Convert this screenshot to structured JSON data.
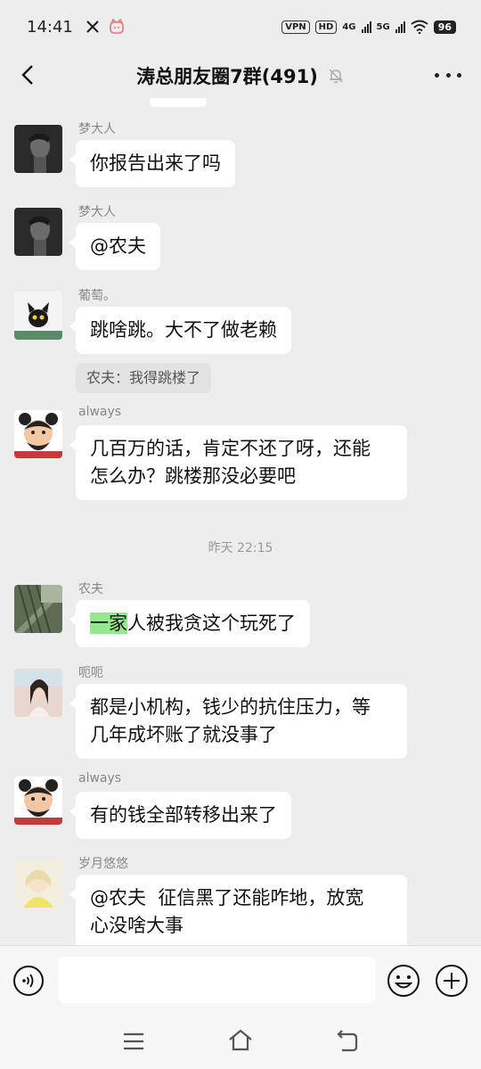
{
  "status_bar": {
    "time": "14:41",
    "vpn": "VPN",
    "hd": "HD",
    "net1": "4G",
    "net2": "5G",
    "battery": "96"
  },
  "header": {
    "title": "涛总朋友圈7群(491)"
  },
  "messages": [
    {
      "sender": "梦大人",
      "text": "你报告出来了吗"
    },
    {
      "sender": "梦大人",
      "text": "@农夫"
    },
    {
      "sender": "葡萄。",
      "text": "跳啥跳。大不了做老赖",
      "quote": "农夫：我得跳楼了"
    },
    {
      "sender": "always",
      "text_lines": [
        "几百万的话，肯定不还了呀，还能",
        "怎么办？跳楼那没必要吧"
      ]
    },
    {
      "sender": "农夫",
      "text_highlight": "一家",
      "text_rest": "人被我贪这个玩死了"
    },
    {
      "sender": "呃呃",
      "text_lines": [
        "都是小机构，钱少的抗住压力，等",
        "几年成坏账了就没事了"
      ]
    },
    {
      "sender": "always",
      "text": "有的钱全部转移出来了"
    },
    {
      "sender": "岁月悠悠",
      "text_lines": [
        "@农夫  征信黑了还能咋地，放宽",
        "心没啥大事"
      ]
    }
  ],
  "timestamp": "昨天 22:15",
  "colors": {
    "background": "#ededed",
    "bubble": "#ffffff",
    "highlight": "#95e98d"
  },
  "icons": [
    "back-arrow-icon",
    "mute-bell-icon",
    "more-icon",
    "voice-icon",
    "emoji-icon",
    "plus-icon",
    "menu-icon",
    "home-icon",
    "back-icon"
  ]
}
